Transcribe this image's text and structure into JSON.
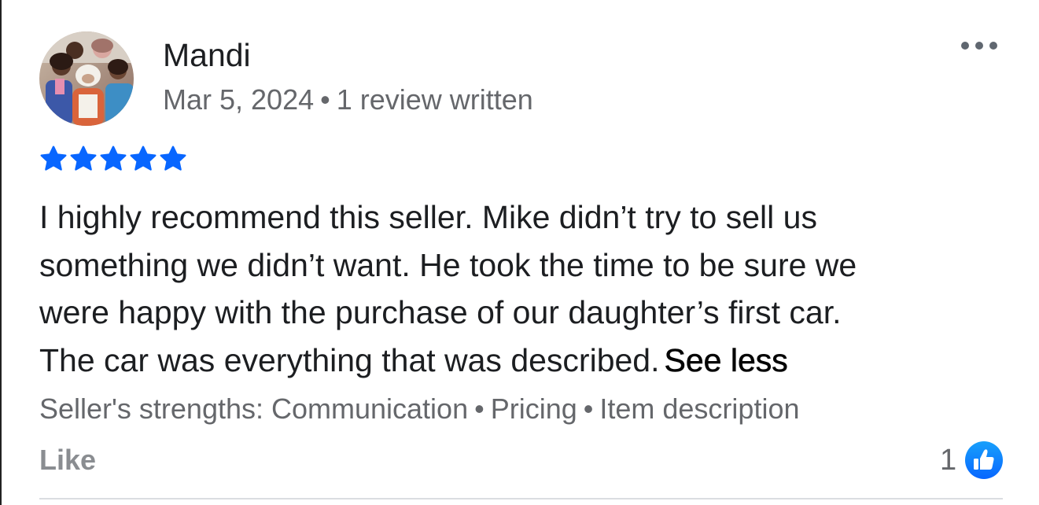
{
  "review": {
    "author": "Mandi",
    "date": "Mar 5, 2024",
    "meta_separator": "•",
    "review_count": "1 review written",
    "rating": 5,
    "rating_color": "#0866ff",
    "text_lines": [
      "I highly recommend this seller.  Mike didn’t try to sell us",
      "something we didn’t want.  He took the time to be sure we",
      "were happy with the purchase of our daughter’s first car.",
      "The car was everything that was described."
    ],
    "see_less_label": "See less",
    "strengths": {
      "prefix": "Seller's strengths: ",
      "items": [
        "Communication",
        "Pricing",
        "Item description"
      ],
      "separator": "•"
    },
    "like_label": "Like",
    "like_count": "1",
    "icons": {
      "more": "more-horizontal-icon",
      "star": "star-icon",
      "like_badge": "thumbs-up-icon"
    }
  }
}
